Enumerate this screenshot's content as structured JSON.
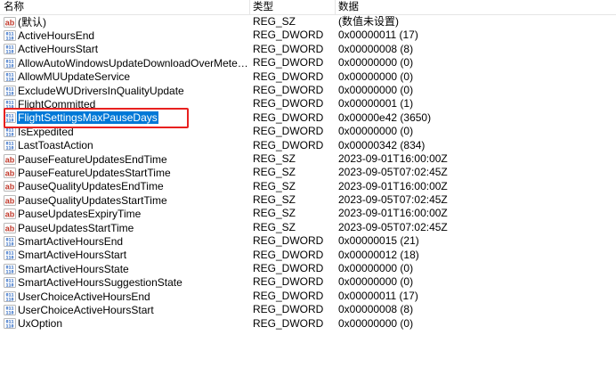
{
  "columns": {
    "name": "名称",
    "type": "类型",
    "data": "数据"
  },
  "rows": [
    {
      "icon": "string-value-icon",
      "name": "(默认)",
      "type": "REG_SZ",
      "data": "(数值未设置)"
    },
    {
      "icon": "binary-value-icon",
      "name": "ActiveHoursEnd",
      "type": "REG_DWORD",
      "data": "0x00000011 (17)"
    },
    {
      "icon": "binary-value-icon",
      "name": "ActiveHoursStart",
      "type": "REG_DWORD",
      "data": "0x00000008 (8)"
    },
    {
      "icon": "binary-value-icon",
      "name": "AllowAutoWindowsUpdateDownloadOverMeteredNe...",
      "type": "REG_DWORD",
      "data": "0x00000000 (0)"
    },
    {
      "icon": "binary-value-icon",
      "name": "AllowMUUpdateService",
      "type": "REG_DWORD",
      "data": "0x00000000 (0)"
    },
    {
      "icon": "binary-value-icon",
      "name": "ExcludeWUDriversInQualityUpdate",
      "type": "REG_DWORD",
      "data": "0x00000000 (0)"
    },
    {
      "icon": "binary-value-icon",
      "name": "FlightCommitted",
      "type": "REG_DWORD",
      "data": "0x00000001 (1)"
    },
    {
      "icon": "binary-value-icon",
      "name": "FlightSettingsMaxPauseDays",
      "type": "REG_DWORD",
      "data": "0x00000e42 (3650)",
      "selected": true
    },
    {
      "icon": "binary-value-icon",
      "name": "IsExpedited",
      "type": "REG_DWORD",
      "data": "0x00000000 (0)"
    },
    {
      "icon": "binary-value-icon",
      "name": "LastToastAction",
      "type": "REG_DWORD",
      "data": "0x00000342 (834)"
    },
    {
      "icon": "string-value-icon",
      "name": "PauseFeatureUpdatesEndTime",
      "type": "REG_SZ",
      "data": "2023-09-01T16:00:00Z"
    },
    {
      "icon": "string-value-icon",
      "name": "PauseFeatureUpdatesStartTime",
      "type": "REG_SZ",
      "data": "2023-09-05T07:02:45Z"
    },
    {
      "icon": "string-value-icon",
      "name": "PauseQualityUpdatesEndTime",
      "type": "REG_SZ",
      "data": "2023-09-01T16:00:00Z"
    },
    {
      "icon": "string-value-icon",
      "name": "PauseQualityUpdatesStartTime",
      "type": "REG_SZ",
      "data": "2023-09-05T07:02:45Z"
    },
    {
      "icon": "string-value-icon",
      "name": "PauseUpdatesExpiryTime",
      "type": "REG_SZ",
      "data": "2023-09-01T16:00:00Z"
    },
    {
      "icon": "string-value-icon",
      "name": "PauseUpdatesStartTime",
      "type": "REG_SZ",
      "data": "2023-09-05T07:02:45Z"
    },
    {
      "icon": "binary-value-icon",
      "name": "SmartActiveHoursEnd",
      "type": "REG_DWORD",
      "data": "0x00000015 (21)"
    },
    {
      "icon": "binary-value-icon",
      "name": "SmartActiveHoursStart",
      "type": "REG_DWORD",
      "data": "0x00000012 (18)"
    },
    {
      "icon": "binary-value-icon",
      "name": "SmartActiveHoursState",
      "type": "REG_DWORD",
      "data": "0x00000000 (0)"
    },
    {
      "icon": "binary-value-icon",
      "name": "SmartActiveHoursSuggestionState",
      "type": "REG_DWORD",
      "data": "0x00000000 (0)"
    },
    {
      "icon": "binary-value-icon",
      "name": "UserChoiceActiveHoursEnd",
      "type": "REG_DWORD",
      "data": "0x00000011 (17)"
    },
    {
      "icon": "binary-value-icon",
      "name": "UserChoiceActiveHoursStart",
      "type": "REG_DWORD",
      "data": "0x00000008 (8)"
    },
    {
      "icon": "binary-value-icon",
      "name": "UxOption",
      "type": "REG_DWORD",
      "data": "0x00000000 (0)"
    }
  ],
  "colors": {
    "selection": "#0078d7",
    "highlight_box": "#e8201f",
    "string_icon": "#c0392b",
    "binary_icon": "#1f5fbf"
  }
}
